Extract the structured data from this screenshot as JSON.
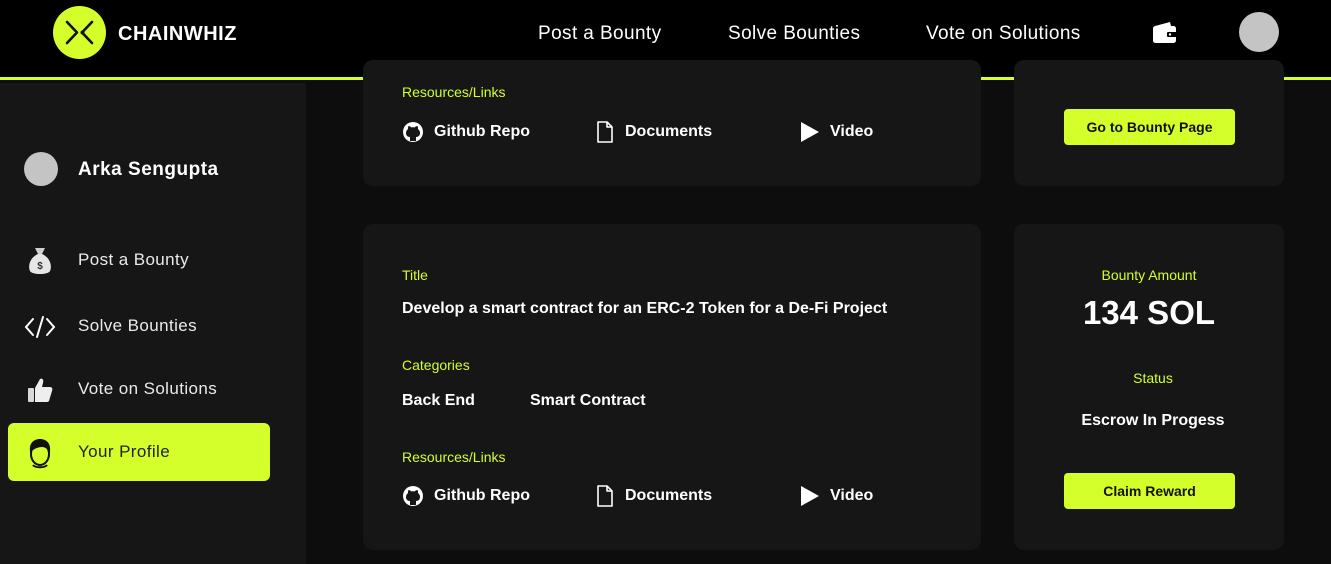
{
  "brand": {
    "name": "CHAINWHIZ",
    "accent": "#d4ff2a"
  },
  "nav": {
    "post": "Post a Bounty",
    "solve": "Solve Bounties",
    "vote": "Vote on Solutions"
  },
  "sidebar": {
    "user_name": "Arka Sengupta",
    "items": [
      {
        "label": "Post a Bounty",
        "icon": "money-bag-icon"
      },
      {
        "label": "Solve Bounties",
        "icon": "code-icon"
      },
      {
        "label": "Vote on Solutions",
        "icon": "thumbs-up-icon"
      },
      {
        "label": "Your Profile",
        "icon": "person-icon",
        "active": true
      }
    ]
  },
  "card_top": {
    "resources_label": "Resources/Links",
    "resources": [
      "Github Repo",
      "Documents",
      "Video"
    ],
    "button": "Go to Bounty Page"
  },
  "card_main": {
    "title_label": "Title",
    "title": "Develop a smart contract for an ERC-2 Token for a De-Fi Project",
    "categories_label": "Categories",
    "categories": [
      "Back End",
      "Smart Contract"
    ],
    "resources_label": "Resources/Links",
    "resources": [
      "Github Repo",
      "Documents",
      "Video"
    ],
    "amount_label": "Bounty Amount",
    "amount": "134 SOL",
    "status_label": "Status",
    "status": "Escrow In Progess",
    "button": "Claim Reward"
  }
}
